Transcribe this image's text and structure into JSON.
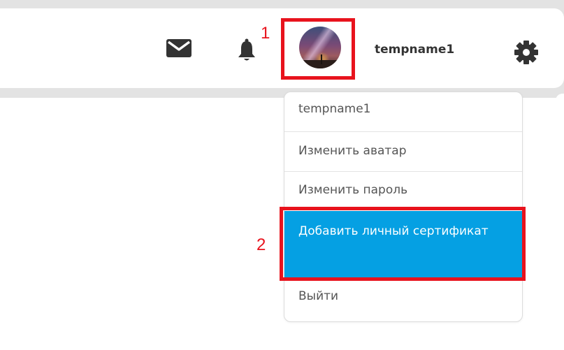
{
  "header": {
    "username": "tempname1",
    "icons": {
      "mail": "mail-icon",
      "bell": "bell-icon",
      "settings": "gear-icon"
    }
  },
  "user_menu": {
    "items": [
      {
        "label": "tempname1"
      },
      {
        "label": "Изменить аватар"
      },
      {
        "label": "Изменить пароль"
      },
      {
        "label": "Добавить личный сертификат",
        "highlighted": true
      },
      {
        "label": "Выйти"
      }
    ],
    "highlight_color": "#05a0e3"
  },
  "annotations": {
    "marker_1": "1",
    "marker_2": "2",
    "color": "#e8131d"
  }
}
